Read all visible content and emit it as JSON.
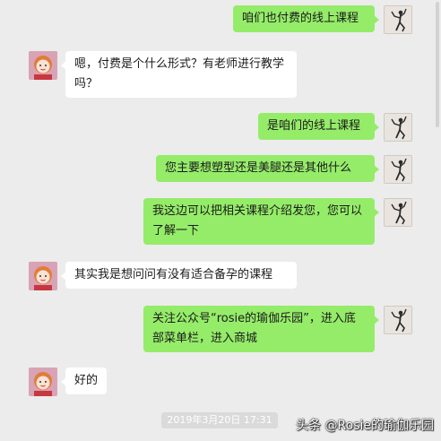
{
  "chat": {
    "messages": [
      {
        "sender": "me",
        "text": "咱们也付费的线上课程"
      },
      {
        "sender": "other",
        "text": "嗯，付费是个什么形式？有老师进行教学吗？"
      },
      {
        "sender": "me",
        "text": "是咱们的线上课程"
      },
      {
        "sender": "me",
        "text": "您主要想塑型还是美腿还是其他什么"
      },
      {
        "sender": "me",
        "text": "我这边可以把相关课程介绍发您，您可以了解一下"
      },
      {
        "sender": "other",
        "text": "其实我是想问问有没有适合备孕的课程"
      },
      {
        "sender": "me",
        "text": "关注公众号“rosie的瑜伽乐园”，进入底部菜单栏，进入商城"
      },
      {
        "sender": "other",
        "text": "好的"
      }
    ],
    "timestamp": "2019年3月20日 17:31"
  },
  "watermark": "头条 @Rosie的瑜伽乐园",
  "colors": {
    "background": "#ececec",
    "my_bubble": "#95ec69",
    "their_bubble": "#ffffff"
  },
  "icons": {
    "my_avatar": "yoga-pose-avatar",
    "their_avatar": "cartoon-girl-avatar"
  }
}
